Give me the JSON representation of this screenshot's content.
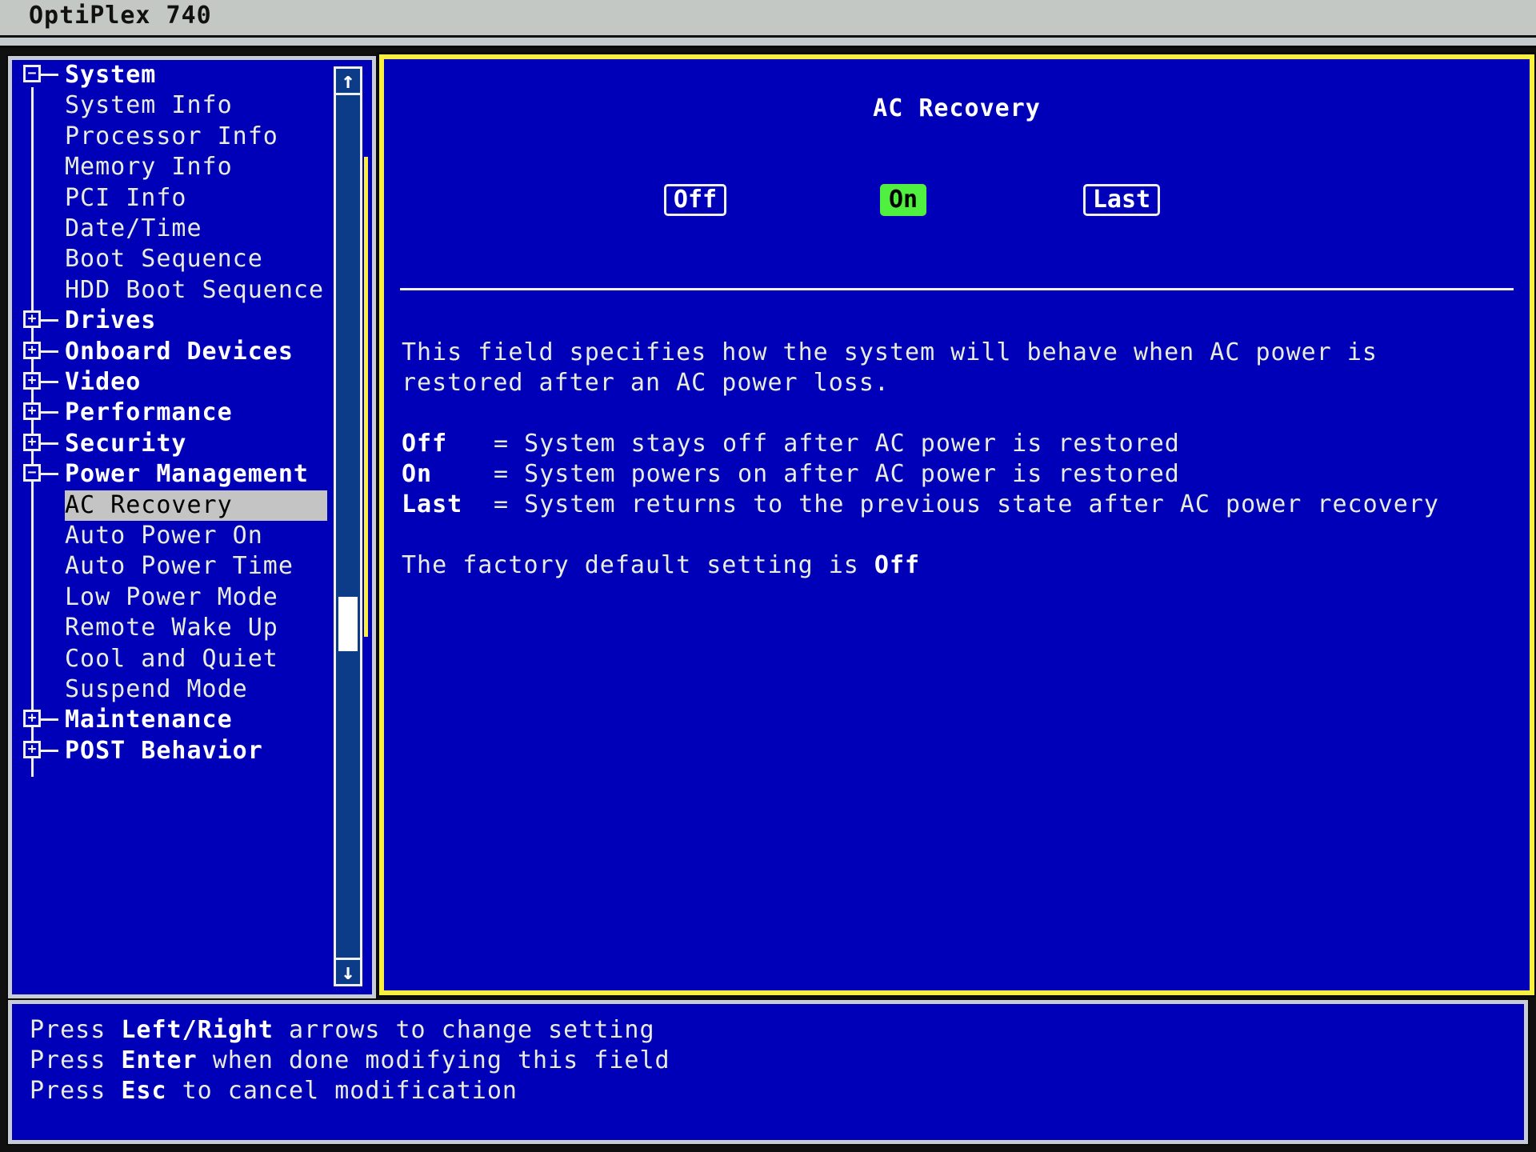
{
  "window": {
    "title": "OptiPlex 740"
  },
  "colors": {
    "background_blue": "#0000b8",
    "active_border": "#f8f040",
    "selected_option": "#50f040",
    "selected_tree_item": "#c4c4c4"
  },
  "tree": {
    "items": [
      {
        "label": "System",
        "level": 0,
        "expander": "minus"
      },
      {
        "label": "System Info",
        "level": 1
      },
      {
        "label": "Processor Info",
        "level": 1
      },
      {
        "label": "Memory Info",
        "level": 1
      },
      {
        "label": "PCI Info",
        "level": 1
      },
      {
        "label": "Date/Time",
        "level": 1
      },
      {
        "label": "Boot Sequence",
        "level": 1
      },
      {
        "label": "HDD Boot Sequence",
        "level": 1
      },
      {
        "label": "Drives",
        "level": 0,
        "expander": "plus"
      },
      {
        "label": "Onboard Devices",
        "level": 0,
        "expander": "plus"
      },
      {
        "label": "Video",
        "level": 0,
        "expander": "plus"
      },
      {
        "label": "Performance",
        "level": 0,
        "expander": "plus"
      },
      {
        "label": "Security",
        "level": 0,
        "expander": "plus"
      },
      {
        "label": "Power Management",
        "level": 0,
        "expander": "minus"
      },
      {
        "label": "AC Recovery",
        "level": 1,
        "selected": true
      },
      {
        "label": "Auto Power On",
        "level": 1
      },
      {
        "label": "Auto Power Time",
        "level": 1
      },
      {
        "label": "Low Power Mode",
        "level": 1
      },
      {
        "label": "Remote Wake Up",
        "level": 1
      },
      {
        "label": "Cool and Quiet",
        "level": 1
      },
      {
        "label": "Suspend Mode",
        "level": 1
      },
      {
        "label": "Maintenance",
        "level": 0,
        "expander": "plus"
      },
      {
        "label": "POST Behavior",
        "level": 0,
        "expander": "plus"
      }
    ],
    "scroll": {
      "up_icon": "↑",
      "down_icon": "↓"
    }
  },
  "setting": {
    "title": "AC Recovery",
    "options": [
      {
        "label": "Off",
        "selected": false
      },
      {
        "label": "On",
        "selected": true
      },
      {
        "label": "Last",
        "selected": false
      }
    ],
    "description": [
      "This field specifies how the system will behave when AC power is",
      "restored after an AC power loss."
    ],
    "definitions": [
      {
        "key": "Off",
        "text": " = System stays off after AC power is restored"
      },
      {
        "key": "On",
        "text": " = System powers on after AC power is restored"
      },
      {
        "key": "Last",
        "text": " = System returns to the previous state after AC power recovery"
      }
    ],
    "default_prefix": "The factory default setting is ",
    "default_value": "Off"
  },
  "hints": [
    {
      "pre": "Press ",
      "key": "Left/Right",
      "post": " arrows to change setting"
    },
    {
      "pre": "Press ",
      "key": "Enter",
      "post": " when done modifying this field"
    },
    {
      "pre": "Press ",
      "key": "Esc",
      "post": " to cancel modification"
    }
  ]
}
